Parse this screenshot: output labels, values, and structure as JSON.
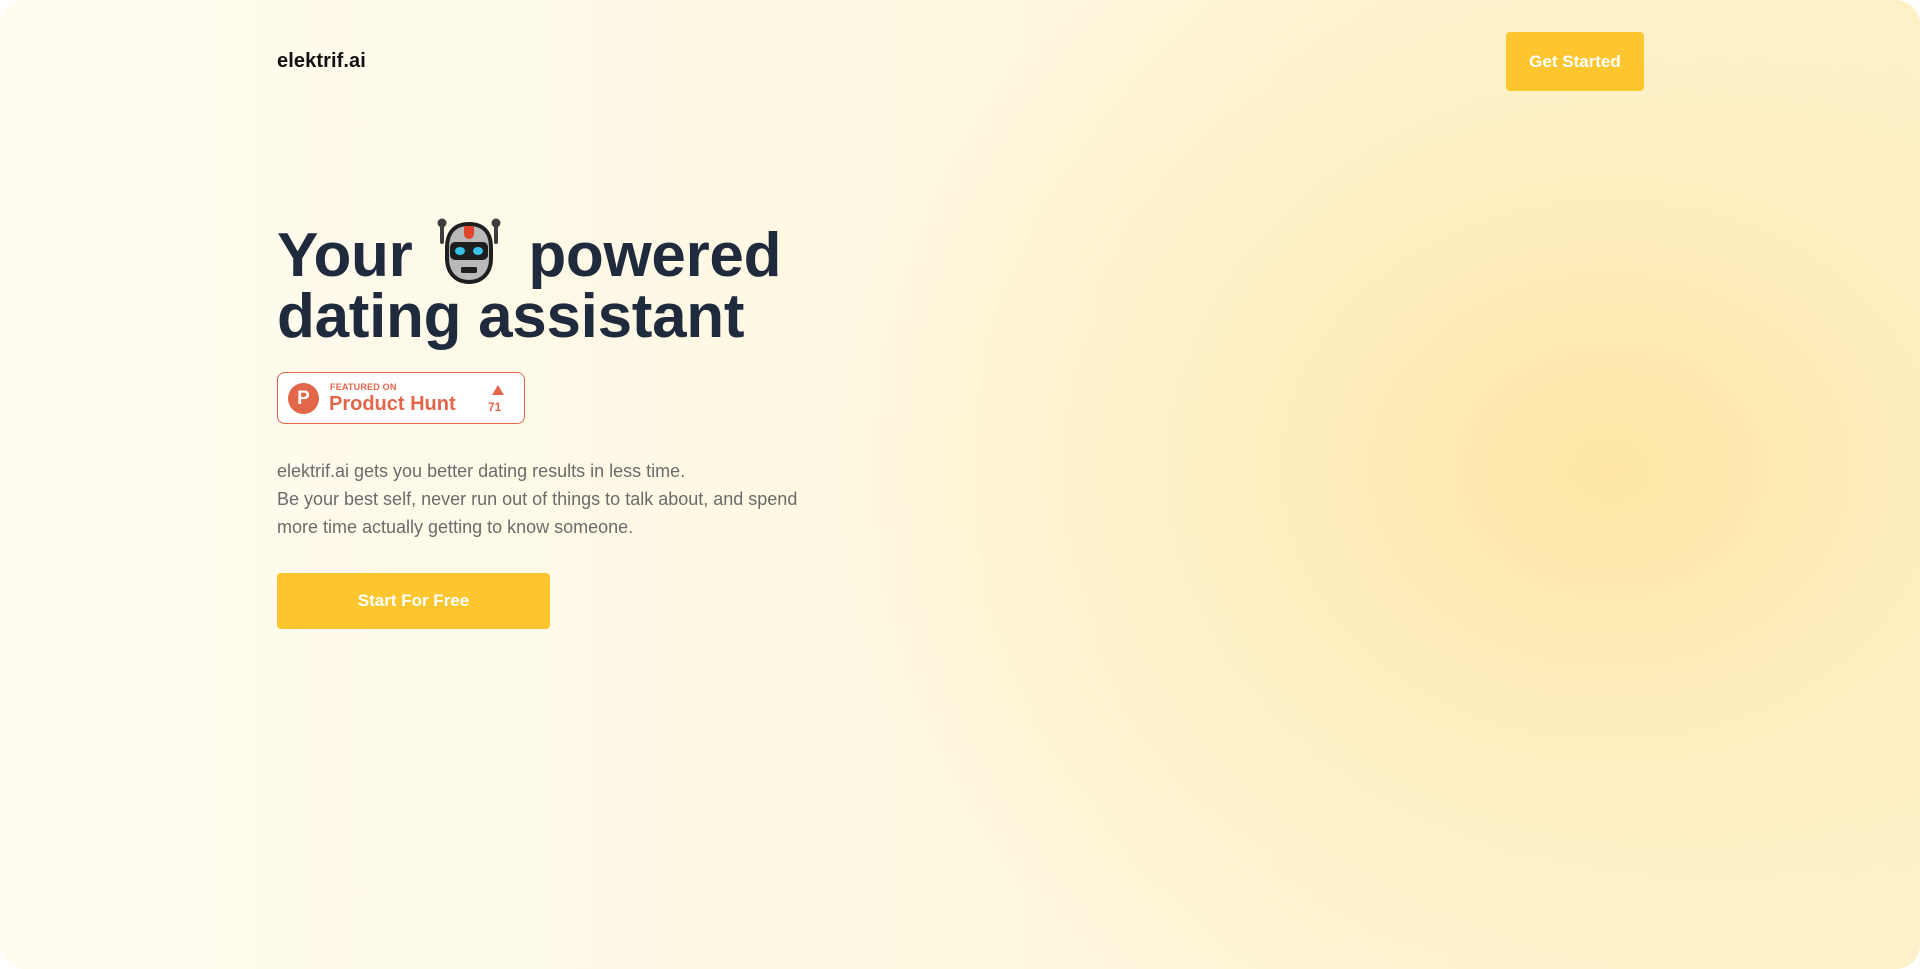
{
  "header": {
    "logo_text": "elektrif.ai",
    "cta_label": "Get Started"
  },
  "hero": {
    "title_before_icon": "Your",
    "title_icon": "robot-face-icon",
    "title_after_icon": "powered",
    "title_line2": "dating assistant",
    "description": [
      "elektrif.ai gets you better dating results in less time.",
      "Be your best self, never run out of things to talk about, and spend more time actually getting to know someone."
    ],
    "cta_label": "Start For Free"
  },
  "product_hunt_badge": {
    "featured_text": "FEATURED ON",
    "name": "Product Hunt",
    "logo_letter": "P",
    "votes": "71",
    "icon": "upvote-arrow-icon"
  },
  "colors": {
    "accent": "#fec62e",
    "heading": "#1f2a3c",
    "body_text": "#6b6b6b",
    "product_hunt": "#e2664a",
    "background_light": "#fffcf1",
    "background_warm": "#fee7a6"
  }
}
